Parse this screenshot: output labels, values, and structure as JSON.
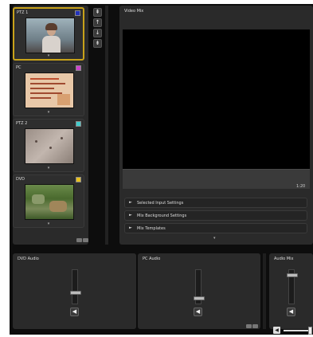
{
  "sources": [
    {
      "label": "PTZ 1",
      "badge_color": "#2233bb",
      "selected": true
    },
    {
      "label": "PC",
      "badge_color": "#cc44cc",
      "selected": false
    },
    {
      "label": "PTZ 2",
      "badge_color": "#44cccc",
      "selected": false
    },
    {
      "label": "DVD",
      "badge_color": "#e8c020",
      "selected": false
    }
  ],
  "vertical_buttons": [
    {
      "icon": "double-chevron-up-icon",
      "glyph": "⇞"
    },
    {
      "icon": "chevron-up-icon",
      "glyph": "↑"
    },
    {
      "icon": "chevron-down-icon",
      "glyph": "↓"
    },
    {
      "icon": "double-chevron-down-icon",
      "glyph": "⇟"
    }
  ],
  "video_mix": {
    "title": "Video Mix",
    "zoom": "1:20"
  },
  "accordions": [
    {
      "label": "Selected Input Settings"
    },
    {
      "label": "Mix Background Settings"
    },
    {
      "label": "Mix Templates"
    }
  ],
  "audio": {
    "dvd_audio": {
      "title": "DVD Audio",
      "level": 0.35
    },
    "pc_audio": {
      "title": "PC Audio",
      "level": 0.2
    },
    "audio_mix": {
      "title": "Audio Mix",
      "level": 0.85
    }
  },
  "glyphs": {
    "chevron_down": "▾",
    "chevron_right": "►",
    "speaker": "◀"
  },
  "colors": {
    "selected_border": "#c8a21a",
    "app_bg": "#0d0d0d",
    "panel_bg": "#2a2a2a"
  }
}
